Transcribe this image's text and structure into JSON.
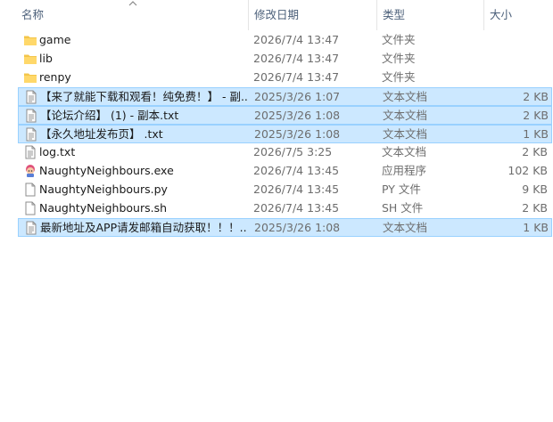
{
  "columns": {
    "name": "名称",
    "date": "修改日期",
    "type": "类型",
    "size": "大小"
  },
  "files": [
    {
      "name": "game",
      "date": "2026/7/4 13:47",
      "type": "文件夹",
      "size": "",
      "icon": "folder-icon",
      "selected": false
    },
    {
      "name": "lib",
      "date": "2026/7/4 13:47",
      "type": "文件夹",
      "size": "",
      "icon": "folder-icon",
      "selected": false
    },
    {
      "name": "renpy",
      "date": "2026/7/4 13:47",
      "type": "文件夹",
      "size": "",
      "icon": "folder-icon",
      "selected": false
    },
    {
      "name": "【来了就能下载和观看！纯免费！】 - 副...",
      "date": "2025/3/26 1:07",
      "type": "文本文档",
      "size": "2 KB",
      "icon": "text-file-icon",
      "selected": true
    },
    {
      "name": "【论坛介绍】 (1) - 副本.txt",
      "date": "2025/3/26 1:08",
      "type": "文本文档",
      "size": "2 KB",
      "icon": "text-file-icon",
      "selected": true
    },
    {
      "name": "【永久地址发布页】 .txt",
      "date": "2025/3/26 1:08",
      "type": "文本文档",
      "size": "1 KB",
      "icon": "text-file-icon",
      "selected": true
    },
    {
      "name": "log.txt",
      "date": "2026/7/5 3:25",
      "type": "文本文档",
      "size": "2 KB",
      "icon": "text-file-icon",
      "selected": false
    },
    {
      "name": "NaughtyNeighbours.exe",
      "date": "2026/7/4 13:45",
      "type": "应用程序",
      "size": "102 KB",
      "icon": "app-icon",
      "selected": false
    },
    {
      "name": "NaughtyNeighbours.py",
      "date": "2026/7/4 13:45",
      "type": "PY 文件",
      "size": "9 KB",
      "icon": "blank-file-icon",
      "selected": false
    },
    {
      "name": "NaughtyNeighbours.sh",
      "date": "2026/7/4 13:45",
      "type": "SH 文件",
      "size": "2 KB",
      "icon": "blank-file-icon",
      "selected": false
    },
    {
      "name": "最新地址及APP请发邮箱自动获取！！！...",
      "date": "2025/3/26 1:08",
      "type": "文本文档",
      "size": "1 KB",
      "icon": "text-file-icon",
      "selected": true
    }
  ]
}
